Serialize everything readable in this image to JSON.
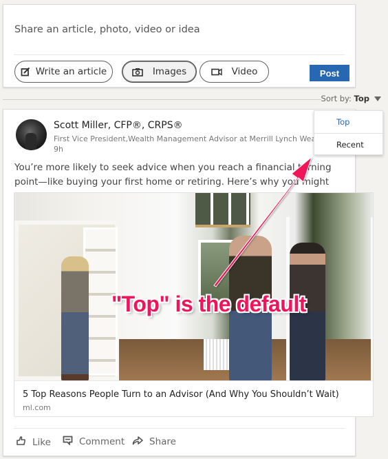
{
  "share_box": {
    "prompt": "Share an article, photo, video or idea",
    "buttons": [
      {
        "label": "Write an article",
        "icon": "edit-icon"
      },
      {
        "label": "Images",
        "icon": "camera-icon"
      },
      {
        "label": "Video",
        "icon": "video-icon"
      }
    ],
    "post_label": "Post"
  },
  "sort": {
    "label": "Sort by:",
    "value": "Top",
    "options": [
      "Top",
      "Recent"
    ],
    "selected": "Top"
  },
  "post": {
    "author_name": "Scott Miller, CFP®, CRPS®",
    "author_title": "First Vice President,Wealth Management Advisor at Merrill Lynch Wealth",
    "time": "9h",
    "body": "You’re more likely to seek advice when you reach a financial turning point—like buying your first home or retiring. Here’s why you might not want to wait.",
    "article": {
      "title": "5 Top Reasons People Turn to an Advisor (And Why You Shouldn’t Wait)",
      "source": "ml.com"
    },
    "actions": [
      {
        "label": "Like",
        "icon": "thumbs-up-icon"
      },
      {
        "label": "Comment",
        "icon": "comment-icon"
      },
      {
        "label": "Share",
        "icon": "share-arrow-icon"
      }
    ]
  },
  "annotation": {
    "text": "\"Top\" is the default",
    "color": "#f0145a"
  },
  "colors": {
    "brand_blue": "#2867b2",
    "annotation_pink": "#f0145a"
  }
}
